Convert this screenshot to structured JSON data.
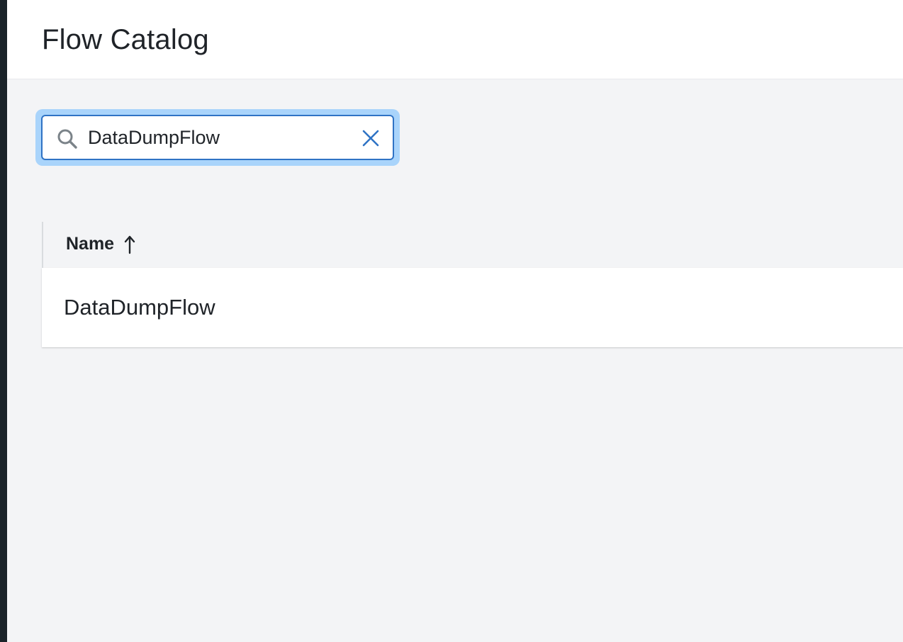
{
  "header": {
    "title": "Flow Catalog"
  },
  "search": {
    "value": "DataDumpFlow",
    "icon": "search-icon",
    "clear_icon": "close-icon"
  },
  "table": {
    "columns": [
      {
        "label": "Name",
        "sort": "ascending",
        "sort_icon": "arrow-up-icon"
      }
    ],
    "rows": [
      {
        "name": "DataDumpFlow"
      }
    ]
  },
  "colors": {
    "accent": "#2f73c5",
    "focus_ring": "#a9d4fb",
    "background": "#f3f4f6",
    "rail": "#1a2329"
  }
}
